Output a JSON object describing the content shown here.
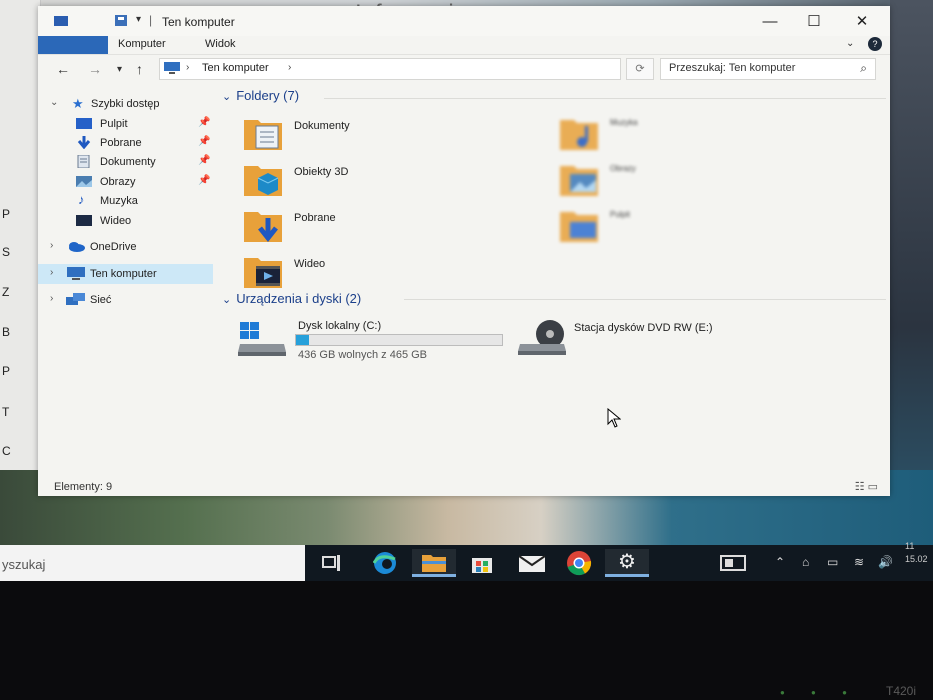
{
  "background": {
    "bg_title_fragment": "Informacje",
    "bg_window_letters": [
      "P",
      "S",
      "Z",
      "B",
      "P",
      "T",
      "C"
    ]
  },
  "window": {
    "title": "Ten komputer",
    "ribbon_tabs": [
      "Komputer",
      "Widok"
    ],
    "address": {
      "segments": [
        "Ten komputer"
      ]
    },
    "search_placeholder": "Przeszukaj: Ten komputer",
    "nav": {
      "quick_access": "Szybki dostęp",
      "quick_items": [
        {
          "label": "Pulpit",
          "icon": "desktop-icon"
        },
        {
          "label": "Pobrane",
          "icon": "download-arrow-icon"
        },
        {
          "label": "Dokumenty",
          "icon": "documents-icon"
        },
        {
          "label": "Obrazy",
          "icon": "pictures-icon"
        },
        {
          "label": "Muzyka",
          "icon": "music-note-icon"
        },
        {
          "label": "Wideo",
          "icon": "video-icon"
        }
      ],
      "onedrive": "OneDrive",
      "this_pc": "Ten komputer",
      "network": "Sieć"
    },
    "folders_header": "Foldery (7)",
    "folders": [
      {
        "name": "Dokumenty",
        "icon": "documents-folder-icon"
      },
      {
        "name": "Obiekty 3D",
        "icon": "3d-objects-folder-icon"
      },
      {
        "name": "Pobrane",
        "icon": "downloads-folder-icon"
      },
      {
        "name": "Wideo",
        "icon": "videos-folder-icon"
      },
      {
        "name": "Muzyka",
        "icon": "music-folder-icon"
      },
      {
        "name": "Obrazy",
        "icon": "pictures-folder-icon"
      },
      {
        "name": "Pulpit",
        "icon": "desktop-folder-icon"
      }
    ],
    "devices_header": "Urządzenia i dyski (2)",
    "drives": [
      {
        "name": "Dysk lokalny (C:)",
        "free_text": "436 GB wolnych z 465 GB",
        "used_fraction": 0.062
      },
      {
        "name": "Stacja dysków DVD RW (E:)"
      }
    ],
    "status": "Elementy: 9"
  },
  "taskbar": {
    "search_placeholder": "yszukaj",
    "apps": [
      "task-view-icon",
      "edge-icon",
      "file-explorer-icon",
      "store-icon",
      "mail-icon",
      "chrome-icon",
      "settings-icon"
    ],
    "active_app": "settings-icon",
    "clock_time": "11",
    "clock_date": "15.02"
  },
  "bezel_label": "T420i",
  "colors": {
    "accent": "#26a0da",
    "group_header": "#1b3f8a",
    "selected": "#cde8f7"
  }
}
